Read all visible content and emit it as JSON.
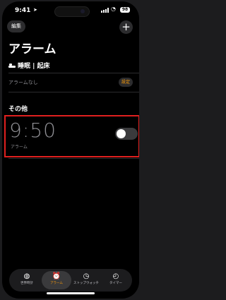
{
  "status": {
    "time": "9:41",
    "battery": "98"
  },
  "header": {
    "edit_label": "編集",
    "add_label": "+"
  },
  "title": "アラーム",
  "sleep": {
    "heading": "睡眠 | 起床",
    "no_alarm": "アラームなし",
    "settings_label": "設定"
  },
  "other": {
    "heading": "その他"
  },
  "alarms": [
    {
      "time": "9:50",
      "label": "アラーム",
      "enabled": false
    }
  ],
  "tabs": [
    {
      "label": "世界時計",
      "icon": "globe-icon",
      "active": false
    },
    {
      "label": "アラーム",
      "icon": "alarm-clock-icon",
      "active": true
    },
    {
      "label": "ストップウォッチ",
      "icon": "stopwatch-icon",
      "active": false
    },
    {
      "label": "タイマー",
      "icon": "timer-icon",
      "active": false
    }
  ],
  "colors": {
    "accent": "#ff9f0a",
    "highlight": "#e0201f",
    "background": "#000000"
  }
}
